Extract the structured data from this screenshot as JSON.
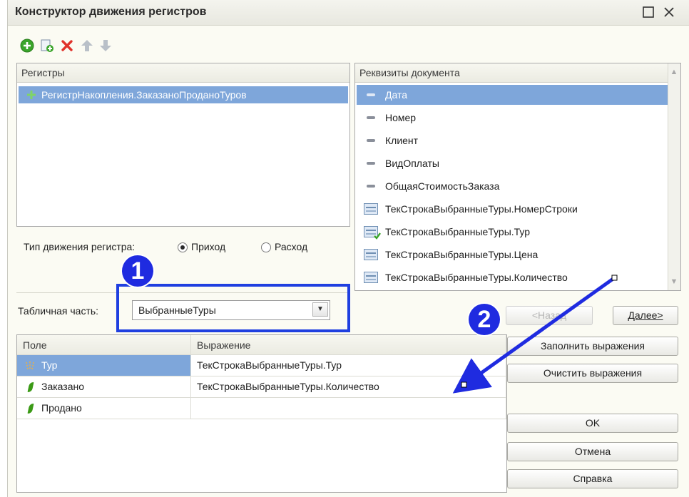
{
  "window": {
    "title": "Конструктор движения регистров"
  },
  "toolbar": {
    "icons": [
      "add-icon",
      "copy-icon",
      "delete-icon",
      "move-up-icon",
      "move-down-icon"
    ]
  },
  "registers_panel": {
    "header": "Регистры",
    "items": [
      {
        "label": "РегистрНакопления.ЗаказаноПроданоТуров",
        "selected": true
      }
    ]
  },
  "movement_type": {
    "label": "Тип движения регистра:",
    "options": [
      {
        "label": "Приход",
        "selected": true
      },
      {
        "label": "Расход",
        "selected": false
      }
    ]
  },
  "requisites_panel": {
    "header": "Реквизиты документа",
    "items": [
      {
        "label": "Дата",
        "icon": "attribute-icon",
        "selected": true
      },
      {
        "label": "Номер",
        "icon": "attribute-icon",
        "selected": false
      },
      {
        "label": "Клиент",
        "icon": "attribute-icon",
        "selected": false
      },
      {
        "label": "ВидОплаты",
        "icon": "attribute-icon",
        "selected": false
      },
      {
        "label": "ОбщаяСтоимостьЗаказа",
        "icon": "attribute-icon",
        "selected": false
      },
      {
        "label": "ТекСтрокаВыбранныеТуры.НомерСтроки",
        "icon": "table-attribute-icon",
        "selected": false
      },
      {
        "label": "ТекСтрокаВыбранныеТуры.Тур",
        "icon": "table-attribute-checked-icon",
        "selected": false
      },
      {
        "label": "ТекСтрокаВыбранныеТуры.Цена",
        "icon": "table-attribute-icon",
        "selected": false
      },
      {
        "label": "ТекСтрокаВыбранныеТуры.Количество",
        "icon": "table-attribute-icon",
        "selected": false
      }
    ]
  },
  "tabular_part": {
    "label": "Табличная часть:",
    "value": "ВыбранныеТуры"
  },
  "navigation": {
    "back": "<Назад",
    "next": "Далее>"
  },
  "grid": {
    "columns": [
      "Поле",
      "Выражение"
    ],
    "rows": [
      {
        "field": "Тур",
        "expression": "ТекСтрокаВыбранныеТуры.Тур",
        "icon": "dimension-icon",
        "selected": true
      },
      {
        "field": "Заказано",
        "expression": "ТекСтрокаВыбранныеТуры.Количество",
        "icon": "resource-icon",
        "selected": false
      },
      {
        "field": "Продано",
        "expression": "",
        "icon": "resource-icon",
        "selected": false
      }
    ]
  },
  "actions": {
    "fill": "Заполнить выражения",
    "clear": "Очистить выражения",
    "ok": "OK",
    "cancel": "Отмена",
    "help": "Справка"
  },
  "annotations": {
    "badge1": "1",
    "badge2": "2",
    "accent": "#1f2be0"
  }
}
